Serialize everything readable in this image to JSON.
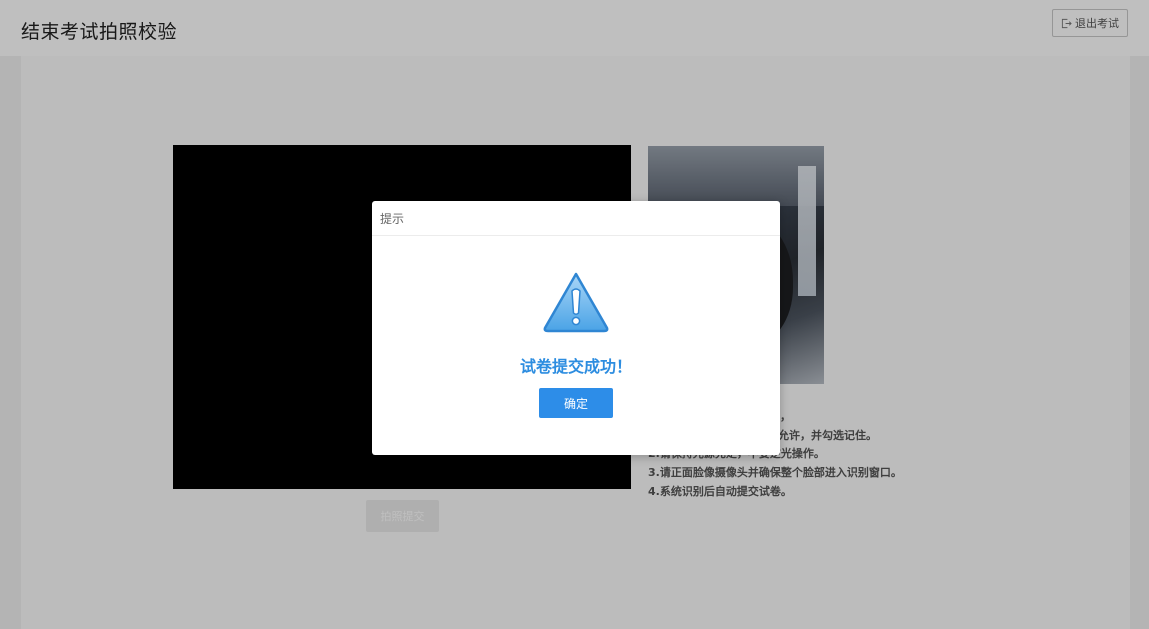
{
  "header": {
    "title": "结束考试拍照校验",
    "exit_label": "退出考试"
  },
  "camera": {
    "capture_label": "拍照提交"
  },
  "instructions": [
    "断的看到您本人的视频头像，",
    "允许，并勾选记住。",
    "2.请保持光源充足，不要逆光操作。",
    "3.请正面脸像摄像头并确保整个脸部进入识别窗口。",
    "4.系统识别后自动提交试卷。"
  ],
  "dialog": {
    "title": "提示",
    "message": "试卷提交成功！",
    "confirm_label": "确定"
  },
  "colors": {
    "accent": "#2d8de8",
    "message": "#2d8de0",
    "overlay": "rgba(0,0,0,0.25)"
  },
  "icons": {
    "exit": "logout-icon",
    "warning": "warning-triangle-icon"
  }
}
